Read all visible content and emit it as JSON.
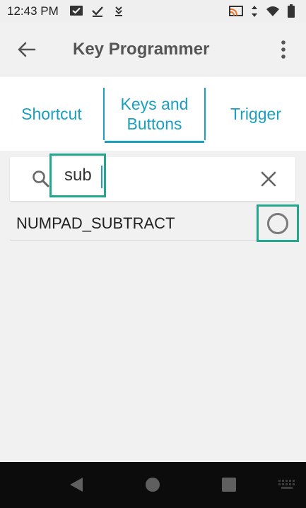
{
  "status_bar": {
    "time": "12:43 PM",
    "icons_left": [
      "message-check-icon",
      "check-icon",
      "download-icon"
    ],
    "icons_right": [
      "cast-icon",
      "data-arrows-icon",
      "wifi-icon",
      "battery-icon"
    ]
  },
  "app_bar": {
    "title": "Key Programmer",
    "back_icon": "back-arrow-icon",
    "more_icon": "more-vert-icon"
  },
  "tabs": [
    {
      "label": "Shortcut",
      "selected": false
    },
    {
      "label_line1": "Keys and",
      "label_line2": "Buttons",
      "selected": true
    },
    {
      "label": "Trigger",
      "selected": false
    }
  ],
  "search": {
    "value": "sub",
    "search_icon": "search-icon",
    "clear_icon": "close-icon"
  },
  "results": [
    {
      "label": "NUMPAD_SUBTRACT",
      "selected": false
    }
  ],
  "nav_bar": {
    "icons": [
      "back-triangle-icon",
      "home-circle-icon",
      "recents-square-icon",
      "keyboard-icon"
    ]
  },
  "colors": {
    "accent": "#1a9fc2",
    "highlight": "#23a68e",
    "background": "#f1f1f1",
    "nav_bar": "#0c0c0c"
  }
}
